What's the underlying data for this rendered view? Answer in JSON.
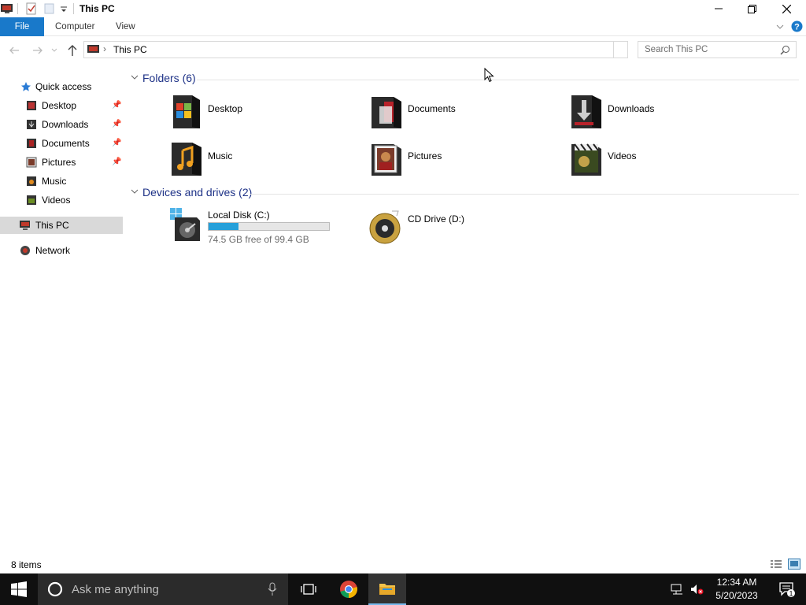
{
  "window": {
    "title": "This PC",
    "menu": {
      "file": "File",
      "computer": "Computer",
      "view": "View"
    }
  },
  "address": {
    "path": "This PC",
    "search_placeholder": "Search This PC"
  },
  "sidebar": {
    "quick_access": "Quick access",
    "items": [
      {
        "label": "Desktop",
        "pinned": true,
        "icon": "desktop-icon"
      },
      {
        "label": "Downloads",
        "pinned": true,
        "icon": "downloads-icon"
      },
      {
        "label": "Documents",
        "pinned": true,
        "icon": "documents-icon"
      },
      {
        "label": "Pictures",
        "pinned": true,
        "icon": "pictures-icon"
      },
      {
        "label": "Music",
        "pinned": false,
        "icon": "music-icon"
      },
      {
        "label": "Videos",
        "pinned": false,
        "icon": "videos-icon"
      }
    ],
    "this_pc": "This PC",
    "network": "Network"
  },
  "folders": {
    "heading": "Folders (6)",
    "items": [
      {
        "label": "Desktop",
        "icon": "desktop-folder-icon"
      },
      {
        "label": "Documents",
        "icon": "documents-folder-icon"
      },
      {
        "label": "Downloads",
        "icon": "downloads-folder-icon"
      },
      {
        "label": "Music",
        "icon": "music-folder-icon"
      },
      {
        "label": "Pictures",
        "icon": "pictures-folder-icon"
      },
      {
        "label": "Videos",
        "icon": "videos-folder-icon"
      }
    ]
  },
  "drives": {
    "heading": "Devices and drives (2)",
    "items": [
      {
        "label": "Local Disk (C:)",
        "free_text": "74.5 GB free of 99.4 GB",
        "used_fraction": 0.25,
        "icon": "hard-drive-icon"
      },
      {
        "label": "CD Drive (D:)",
        "icon": "cd-drive-icon"
      }
    ]
  },
  "status": {
    "count": "8 items"
  },
  "taskbar": {
    "search_placeholder": "Ask me anything",
    "time": "12:34 AM",
    "date": "5/20/2023",
    "notification_count": "1"
  },
  "colors": {
    "accent": "#1979ca",
    "drive_bar": "#26a0da",
    "group_heading": "#1e3287"
  }
}
